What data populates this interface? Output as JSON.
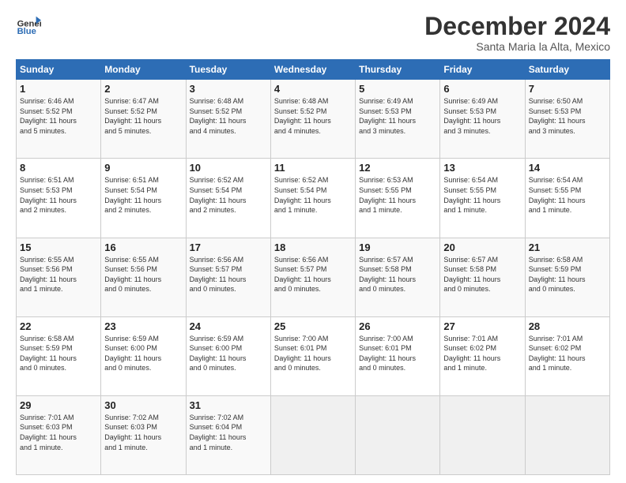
{
  "header": {
    "logo_line1": "General",
    "logo_line2": "Blue",
    "month_title": "December 2024",
    "location": "Santa Maria la Alta, Mexico"
  },
  "weekdays": [
    "Sunday",
    "Monday",
    "Tuesday",
    "Wednesday",
    "Thursday",
    "Friday",
    "Saturday"
  ],
  "weeks": [
    [
      {
        "day": "1",
        "info": "Sunrise: 6:46 AM\nSunset: 5:52 PM\nDaylight: 11 hours\nand 5 minutes."
      },
      {
        "day": "2",
        "info": "Sunrise: 6:47 AM\nSunset: 5:52 PM\nDaylight: 11 hours\nand 5 minutes."
      },
      {
        "day": "3",
        "info": "Sunrise: 6:48 AM\nSunset: 5:52 PM\nDaylight: 11 hours\nand 4 minutes."
      },
      {
        "day": "4",
        "info": "Sunrise: 6:48 AM\nSunset: 5:52 PM\nDaylight: 11 hours\nand 4 minutes."
      },
      {
        "day": "5",
        "info": "Sunrise: 6:49 AM\nSunset: 5:53 PM\nDaylight: 11 hours\nand 3 minutes."
      },
      {
        "day": "6",
        "info": "Sunrise: 6:49 AM\nSunset: 5:53 PM\nDaylight: 11 hours\nand 3 minutes."
      },
      {
        "day": "7",
        "info": "Sunrise: 6:50 AM\nSunset: 5:53 PM\nDaylight: 11 hours\nand 3 minutes."
      }
    ],
    [
      {
        "day": "8",
        "info": "Sunrise: 6:51 AM\nSunset: 5:53 PM\nDaylight: 11 hours\nand 2 minutes."
      },
      {
        "day": "9",
        "info": "Sunrise: 6:51 AM\nSunset: 5:54 PM\nDaylight: 11 hours\nand 2 minutes."
      },
      {
        "day": "10",
        "info": "Sunrise: 6:52 AM\nSunset: 5:54 PM\nDaylight: 11 hours\nand 2 minutes."
      },
      {
        "day": "11",
        "info": "Sunrise: 6:52 AM\nSunset: 5:54 PM\nDaylight: 11 hours\nand 1 minute."
      },
      {
        "day": "12",
        "info": "Sunrise: 6:53 AM\nSunset: 5:55 PM\nDaylight: 11 hours\nand 1 minute."
      },
      {
        "day": "13",
        "info": "Sunrise: 6:54 AM\nSunset: 5:55 PM\nDaylight: 11 hours\nand 1 minute."
      },
      {
        "day": "14",
        "info": "Sunrise: 6:54 AM\nSunset: 5:55 PM\nDaylight: 11 hours\nand 1 minute."
      }
    ],
    [
      {
        "day": "15",
        "info": "Sunrise: 6:55 AM\nSunset: 5:56 PM\nDaylight: 11 hours\nand 1 minute."
      },
      {
        "day": "16",
        "info": "Sunrise: 6:55 AM\nSunset: 5:56 PM\nDaylight: 11 hours\nand 0 minutes."
      },
      {
        "day": "17",
        "info": "Sunrise: 6:56 AM\nSunset: 5:57 PM\nDaylight: 11 hours\nand 0 minutes."
      },
      {
        "day": "18",
        "info": "Sunrise: 6:56 AM\nSunset: 5:57 PM\nDaylight: 11 hours\nand 0 minutes."
      },
      {
        "day": "19",
        "info": "Sunrise: 6:57 AM\nSunset: 5:58 PM\nDaylight: 11 hours\nand 0 minutes."
      },
      {
        "day": "20",
        "info": "Sunrise: 6:57 AM\nSunset: 5:58 PM\nDaylight: 11 hours\nand 0 minutes."
      },
      {
        "day": "21",
        "info": "Sunrise: 6:58 AM\nSunset: 5:59 PM\nDaylight: 11 hours\nand 0 minutes."
      }
    ],
    [
      {
        "day": "22",
        "info": "Sunrise: 6:58 AM\nSunset: 5:59 PM\nDaylight: 11 hours\nand 0 minutes."
      },
      {
        "day": "23",
        "info": "Sunrise: 6:59 AM\nSunset: 6:00 PM\nDaylight: 11 hours\nand 0 minutes."
      },
      {
        "day": "24",
        "info": "Sunrise: 6:59 AM\nSunset: 6:00 PM\nDaylight: 11 hours\nand 0 minutes."
      },
      {
        "day": "25",
        "info": "Sunrise: 7:00 AM\nSunset: 6:01 PM\nDaylight: 11 hours\nand 0 minutes."
      },
      {
        "day": "26",
        "info": "Sunrise: 7:00 AM\nSunset: 6:01 PM\nDaylight: 11 hours\nand 0 minutes."
      },
      {
        "day": "27",
        "info": "Sunrise: 7:01 AM\nSunset: 6:02 PM\nDaylight: 11 hours\nand 1 minute."
      },
      {
        "day": "28",
        "info": "Sunrise: 7:01 AM\nSunset: 6:02 PM\nDaylight: 11 hours\nand 1 minute."
      }
    ],
    [
      {
        "day": "29",
        "info": "Sunrise: 7:01 AM\nSunset: 6:03 PM\nDaylight: 11 hours\nand 1 minute."
      },
      {
        "day": "30",
        "info": "Sunrise: 7:02 AM\nSunset: 6:03 PM\nDaylight: 11 hours\nand 1 minute."
      },
      {
        "day": "31",
        "info": "Sunrise: 7:02 AM\nSunset: 6:04 PM\nDaylight: 11 hours\nand 1 minute."
      },
      {
        "day": "",
        "info": ""
      },
      {
        "day": "",
        "info": ""
      },
      {
        "day": "",
        "info": ""
      },
      {
        "day": "",
        "info": ""
      }
    ]
  ]
}
